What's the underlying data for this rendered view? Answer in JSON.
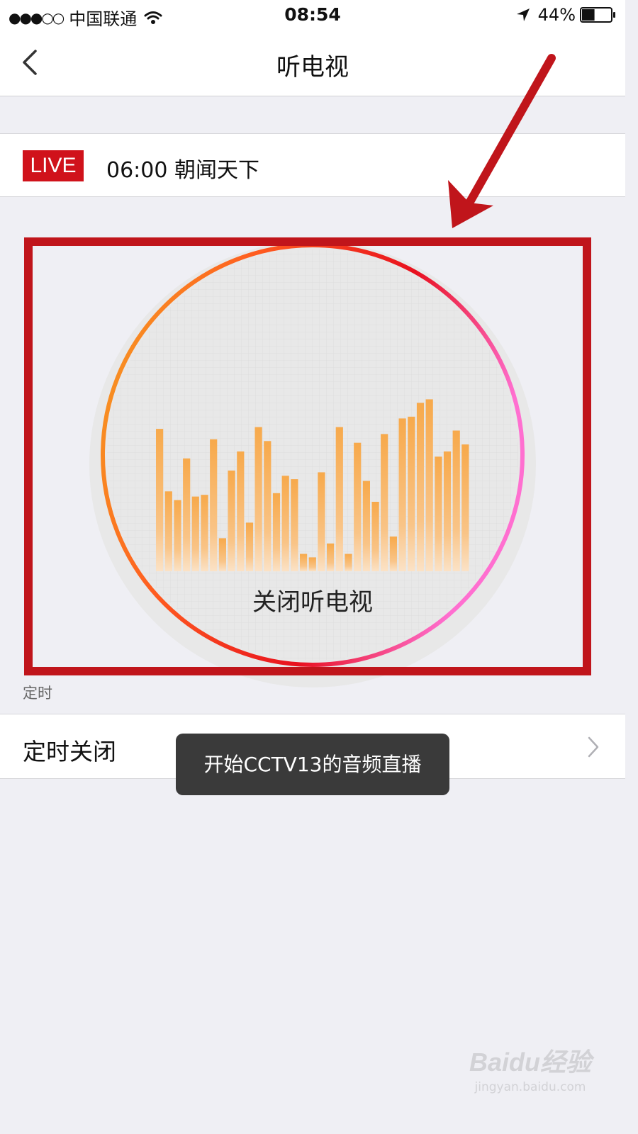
{
  "status_bar": {
    "signal": "●●●○○",
    "carrier": "中国联通",
    "time": "08:54",
    "battery": "44%",
    "battery_level": 0.44
  },
  "nav": {
    "title": "听电视"
  },
  "live": {
    "badge": "LIVE",
    "program": "06:00 朝闻天下"
  },
  "player": {
    "close_label": "关闭听电视",
    "bar_levels": [
      0.82,
      0.46,
      0.41,
      0.65,
      0.43,
      0.44,
      0.76,
      0.19,
      0.58,
      0.69,
      0.28,
      0.83,
      0.75,
      0.45,
      0.55,
      0.53,
      0.1,
      0.08,
      0.57,
      0.16,
      0.83,
      0.1,
      0.74,
      0.52,
      0.4,
      0.79,
      0.2,
      0.88,
      0.89,
      0.97,
      0.99,
      0.66,
      0.69,
      0.81,
      0.73
    ],
    "ring_colors": [
      "#f5a623",
      "#ff5a1f",
      "#e8101e",
      "#ff6fd0"
    ]
  },
  "schedule": {
    "section_label": "定时",
    "timer_label": "定时关闭"
  },
  "toast": {
    "message": "开始CCTV13的音频直播"
  },
  "watermark": {
    "logo": "Baidu经验",
    "url": "jingyan.baidu.com"
  },
  "annotation": {
    "color": "#c0151b"
  }
}
